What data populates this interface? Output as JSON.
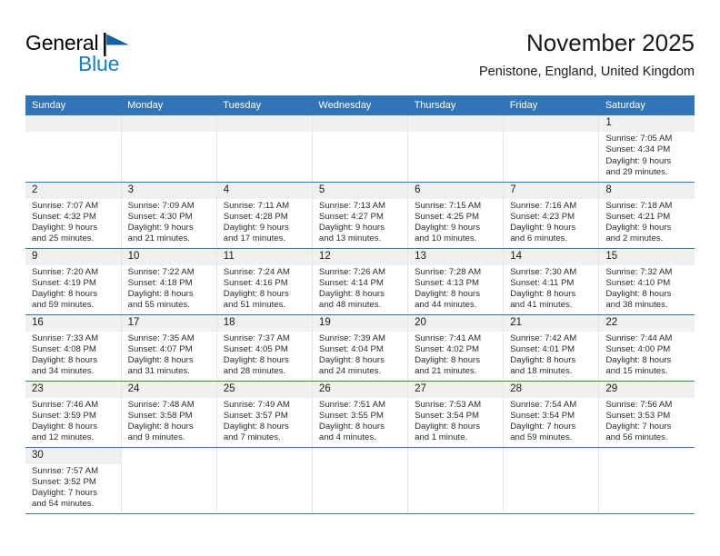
{
  "brand": {
    "line1": "General",
    "line2": "Blue",
    "flag_color": "#1464a5"
  },
  "header": {
    "title": "November 2025",
    "subtitle": "Penistone, England, United Kingdom"
  },
  "theme": {
    "header_bg": "#3274b8",
    "daynum_bg": "#f0f0f0",
    "text": "#1a1a1a"
  },
  "weekdays": [
    "Sunday",
    "Monday",
    "Tuesday",
    "Wednesday",
    "Thursday",
    "Friday",
    "Saturday"
  ],
  "weeks": [
    [
      {
        "empty": true
      },
      {
        "empty": true
      },
      {
        "empty": true
      },
      {
        "empty": true
      },
      {
        "empty": true
      },
      {
        "empty": true
      },
      {
        "day": "1",
        "sunrise": "Sunrise: 7:05 AM",
        "sunset": "Sunset: 4:34 PM",
        "daylight1": "Daylight: 9 hours",
        "daylight2": "and 29 minutes."
      }
    ],
    [
      {
        "day": "2",
        "sunrise": "Sunrise: 7:07 AM",
        "sunset": "Sunset: 4:32 PM",
        "daylight1": "Daylight: 9 hours",
        "daylight2": "and 25 minutes."
      },
      {
        "day": "3",
        "sunrise": "Sunrise: 7:09 AM",
        "sunset": "Sunset: 4:30 PM",
        "daylight1": "Daylight: 9 hours",
        "daylight2": "and 21 minutes."
      },
      {
        "day": "4",
        "sunrise": "Sunrise: 7:11 AM",
        "sunset": "Sunset: 4:28 PM",
        "daylight1": "Daylight: 9 hours",
        "daylight2": "and 17 minutes."
      },
      {
        "day": "5",
        "sunrise": "Sunrise: 7:13 AM",
        "sunset": "Sunset: 4:27 PM",
        "daylight1": "Daylight: 9 hours",
        "daylight2": "and 13 minutes."
      },
      {
        "day": "6",
        "sunrise": "Sunrise: 7:15 AM",
        "sunset": "Sunset: 4:25 PM",
        "daylight1": "Daylight: 9 hours",
        "daylight2": "and 10 minutes."
      },
      {
        "day": "7",
        "sunrise": "Sunrise: 7:16 AM",
        "sunset": "Sunset: 4:23 PM",
        "daylight1": "Daylight: 9 hours",
        "daylight2": "and 6 minutes."
      },
      {
        "day": "8",
        "sunrise": "Sunrise: 7:18 AM",
        "sunset": "Sunset: 4:21 PM",
        "daylight1": "Daylight: 9 hours",
        "daylight2": "and 2 minutes."
      }
    ],
    [
      {
        "day": "9",
        "sunrise": "Sunrise: 7:20 AM",
        "sunset": "Sunset: 4:19 PM",
        "daylight1": "Daylight: 8 hours",
        "daylight2": "and 59 minutes."
      },
      {
        "day": "10",
        "sunrise": "Sunrise: 7:22 AM",
        "sunset": "Sunset: 4:18 PM",
        "daylight1": "Daylight: 8 hours",
        "daylight2": "and 55 minutes."
      },
      {
        "day": "11",
        "sunrise": "Sunrise: 7:24 AM",
        "sunset": "Sunset: 4:16 PM",
        "daylight1": "Daylight: 8 hours",
        "daylight2": "and 51 minutes."
      },
      {
        "day": "12",
        "sunrise": "Sunrise: 7:26 AM",
        "sunset": "Sunset: 4:14 PM",
        "daylight1": "Daylight: 8 hours",
        "daylight2": "and 48 minutes."
      },
      {
        "day": "13",
        "sunrise": "Sunrise: 7:28 AM",
        "sunset": "Sunset: 4:13 PM",
        "daylight1": "Daylight: 8 hours",
        "daylight2": "and 44 minutes."
      },
      {
        "day": "14",
        "sunrise": "Sunrise: 7:30 AM",
        "sunset": "Sunset: 4:11 PM",
        "daylight1": "Daylight: 8 hours",
        "daylight2": "and 41 minutes."
      },
      {
        "day": "15",
        "sunrise": "Sunrise: 7:32 AM",
        "sunset": "Sunset: 4:10 PM",
        "daylight1": "Daylight: 8 hours",
        "daylight2": "and 38 minutes."
      }
    ],
    [
      {
        "day": "16",
        "sunrise": "Sunrise: 7:33 AM",
        "sunset": "Sunset: 4:08 PM",
        "daylight1": "Daylight: 8 hours",
        "daylight2": "and 34 minutes."
      },
      {
        "day": "17",
        "sunrise": "Sunrise: 7:35 AM",
        "sunset": "Sunset: 4:07 PM",
        "daylight1": "Daylight: 8 hours",
        "daylight2": "and 31 minutes."
      },
      {
        "day": "18",
        "sunrise": "Sunrise: 7:37 AM",
        "sunset": "Sunset: 4:05 PM",
        "daylight1": "Daylight: 8 hours",
        "daylight2": "and 28 minutes."
      },
      {
        "day": "19",
        "sunrise": "Sunrise: 7:39 AM",
        "sunset": "Sunset: 4:04 PM",
        "daylight1": "Daylight: 8 hours",
        "daylight2": "and 24 minutes."
      },
      {
        "day": "20",
        "sunrise": "Sunrise: 7:41 AM",
        "sunset": "Sunset: 4:02 PM",
        "daylight1": "Daylight: 8 hours",
        "daylight2": "and 21 minutes."
      },
      {
        "day": "21",
        "sunrise": "Sunrise: 7:42 AM",
        "sunset": "Sunset: 4:01 PM",
        "daylight1": "Daylight: 8 hours",
        "daylight2": "and 18 minutes."
      },
      {
        "day": "22",
        "sunrise": "Sunrise: 7:44 AM",
        "sunset": "Sunset: 4:00 PM",
        "daylight1": "Daylight: 8 hours",
        "daylight2": "and 15 minutes."
      }
    ],
    [
      {
        "day": "23",
        "sunrise": "Sunrise: 7:46 AM",
        "sunset": "Sunset: 3:59 PM",
        "daylight1": "Daylight: 8 hours",
        "daylight2": "and 12 minutes."
      },
      {
        "day": "24",
        "sunrise": "Sunrise: 7:48 AM",
        "sunset": "Sunset: 3:58 PM",
        "daylight1": "Daylight: 8 hours",
        "daylight2": "and 9 minutes."
      },
      {
        "day": "25",
        "sunrise": "Sunrise: 7:49 AM",
        "sunset": "Sunset: 3:57 PM",
        "daylight1": "Daylight: 8 hours",
        "daylight2": "and 7 minutes."
      },
      {
        "day": "26",
        "sunrise": "Sunrise: 7:51 AM",
        "sunset": "Sunset: 3:55 PM",
        "daylight1": "Daylight: 8 hours",
        "daylight2": "and 4 minutes."
      },
      {
        "day": "27",
        "sunrise": "Sunrise: 7:53 AM",
        "sunset": "Sunset: 3:54 PM",
        "daylight1": "Daylight: 8 hours",
        "daylight2": "and 1 minute."
      },
      {
        "day": "28",
        "sunrise": "Sunrise: 7:54 AM",
        "sunset": "Sunset: 3:54 PM",
        "daylight1": "Daylight: 7 hours",
        "daylight2": "and 59 minutes."
      },
      {
        "day": "29",
        "sunrise": "Sunrise: 7:56 AM",
        "sunset": "Sunset: 3:53 PM",
        "daylight1": "Daylight: 7 hours",
        "daylight2": "and 56 minutes."
      }
    ],
    [
      {
        "day": "30",
        "sunrise": "Sunrise: 7:57 AM",
        "sunset": "Sunset: 3:52 PM",
        "daylight1": "Daylight: 7 hours",
        "daylight2": "and 54 minutes."
      },
      {
        "blank": true
      },
      {
        "blank": true
      },
      {
        "blank": true
      },
      {
        "blank": true
      },
      {
        "blank": true
      },
      {
        "blank": true
      }
    ]
  ]
}
